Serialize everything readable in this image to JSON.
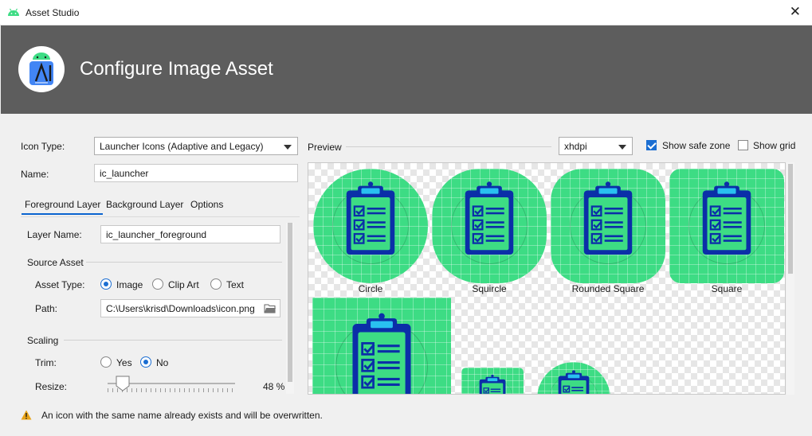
{
  "window": {
    "title": "Asset Studio",
    "close_glyph": "✕"
  },
  "banner": {
    "title": "Configure Image Asset",
    "logo_icon": "android-studio-logo-icon"
  },
  "form": {
    "icon_type_label": "Icon Type:",
    "icon_type_value": "Launcher Icons (Adaptive and Legacy)",
    "name_label": "Name:",
    "name_value": "ic_launcher"
  },
  "tabs": [
    {
      "label": "Foreground Layer",
      "active": true
    },
    {
      "label": "Background Layer",
      "active": false
    },
    {
      "label": "Options",
      "active": false
    }
  ],
  "foreground": {
    "layer_name_label": "Layer Name:",
    "layer_name_value": "ic_launcher_foreground",
    "source_asset_header": "Source Asset",
    "asset_type_label": "Asset Type:",
    "asset_types": [
      {
        "label": "Image",
        "selected": true
      },
      {
        "label": "Clip Art",
        "selected": false
      },
      {
        "label": "Text",
        "selected": false
      }
    ],
    "path_label": "Path:",
    "path_value": "C:\\Users\\krisd\\Downloads\\icon.png",
    "scaling_header": "Scaling",
    "trim_label": "Trim:",
    "trim_options": [
      {
        "label": "Yes",
        "selected": false
      },
      {
        "label": "No",
        "selected": true
      }
    ],
    "resize_label": "Resize:",
    "resize_value": "48 %",
    "resize_percent": 48
  },
  "preview": {
    "label": "Preview",
    "density": "xhdpi",
    "show_safe_zone_label": "Show safe zone",
    "show_safe_zone_checked": true,
    "show_grid_label": "Show grid",
    "show_grid_checked": false,
    "shapes": [
      "Circle",
      "Squircle",
      "Rounded Square",
      "Square"
    ],
    "icon_color": "#3ddc84",
    "glyph_color": "#0b2fa8",
    "clip_color": "#29c1f0"
  },
  "footer": {
    "warning_text": "An icon with the same name already exists and will be overwritten.",
    "warning_icon": "warning-triangle-icon"
  }
}
